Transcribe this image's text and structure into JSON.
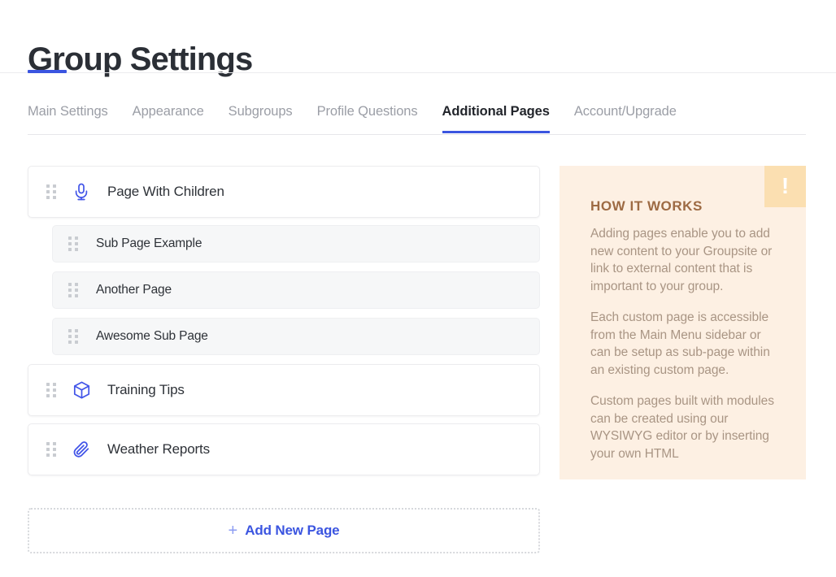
{
  "header": {
    "title": "Group Settings"
  },
  "tabs": [
    {
      "label": "Main Settings",
      "active": false
    },
    {
      "label": "Appearance",
      "active": false
    },
    {
      "label": "Subgroups",
      "active": false
    },
    {
      "label": "Profile Questions",
      "active": false
    },
    {
      "label": "Additional Pages",
      "active": true
    },
    {
      "label": "Account/Upgrade",
      "active": false
    }
  ],
  "pages": [
    {
      "label": "Page With Children",
      "icon": "microphone-icon",
      "level": "top"
    },
    {
      "label": "Sub Page Example",
      "icon": null,
      "level": "sub"
    },
    {
      "label": "Another Page",
      "icon": null,
      "level": "sub"
    },
    {
      "label": "Awesome Sub Page",
      "icon": null,
      "level": "sub"
    },
    {
      "label": "Training Tips",
      "icon": "cube-icon",
      "level": "top"
    },
    {
      "label": "Weather Reports",
      "icon": "paperclip-icon",
      "level": "top"
    }
  ],
  "add_new_page": {
    "plus": "+",
    "label": "Add New Page"
  },
  "how_it_works": {
    "badge_icon": "exclamation-icon",
    "badge_glyph": "!",
    "title": "HOW IT WORKS",
    "paragraphs": [
      "Adding pages enable you to add new content to your Groupsite or link to external content that is important to your group.",
      "Each custom page is accessible from the Main Menu sidebar or can be setup as sub-page within an existing custom page.",
      "Custom pages built with modules can be created using our WYSIWYG editor or by inserting your own HTML"
    ]
  },
  "colors": {
    "accent_blue": "#3b55e0",
    "icon_blue": "#4255e8",
    "panel_bg": "#fdf0e3",
    "badge_bg": "#fbdfb1",
    "panel_title": "#9d6a43",
    "panel_text": "#a99584",
    "subrow_bg": "#f6f7f8"
  }
}
